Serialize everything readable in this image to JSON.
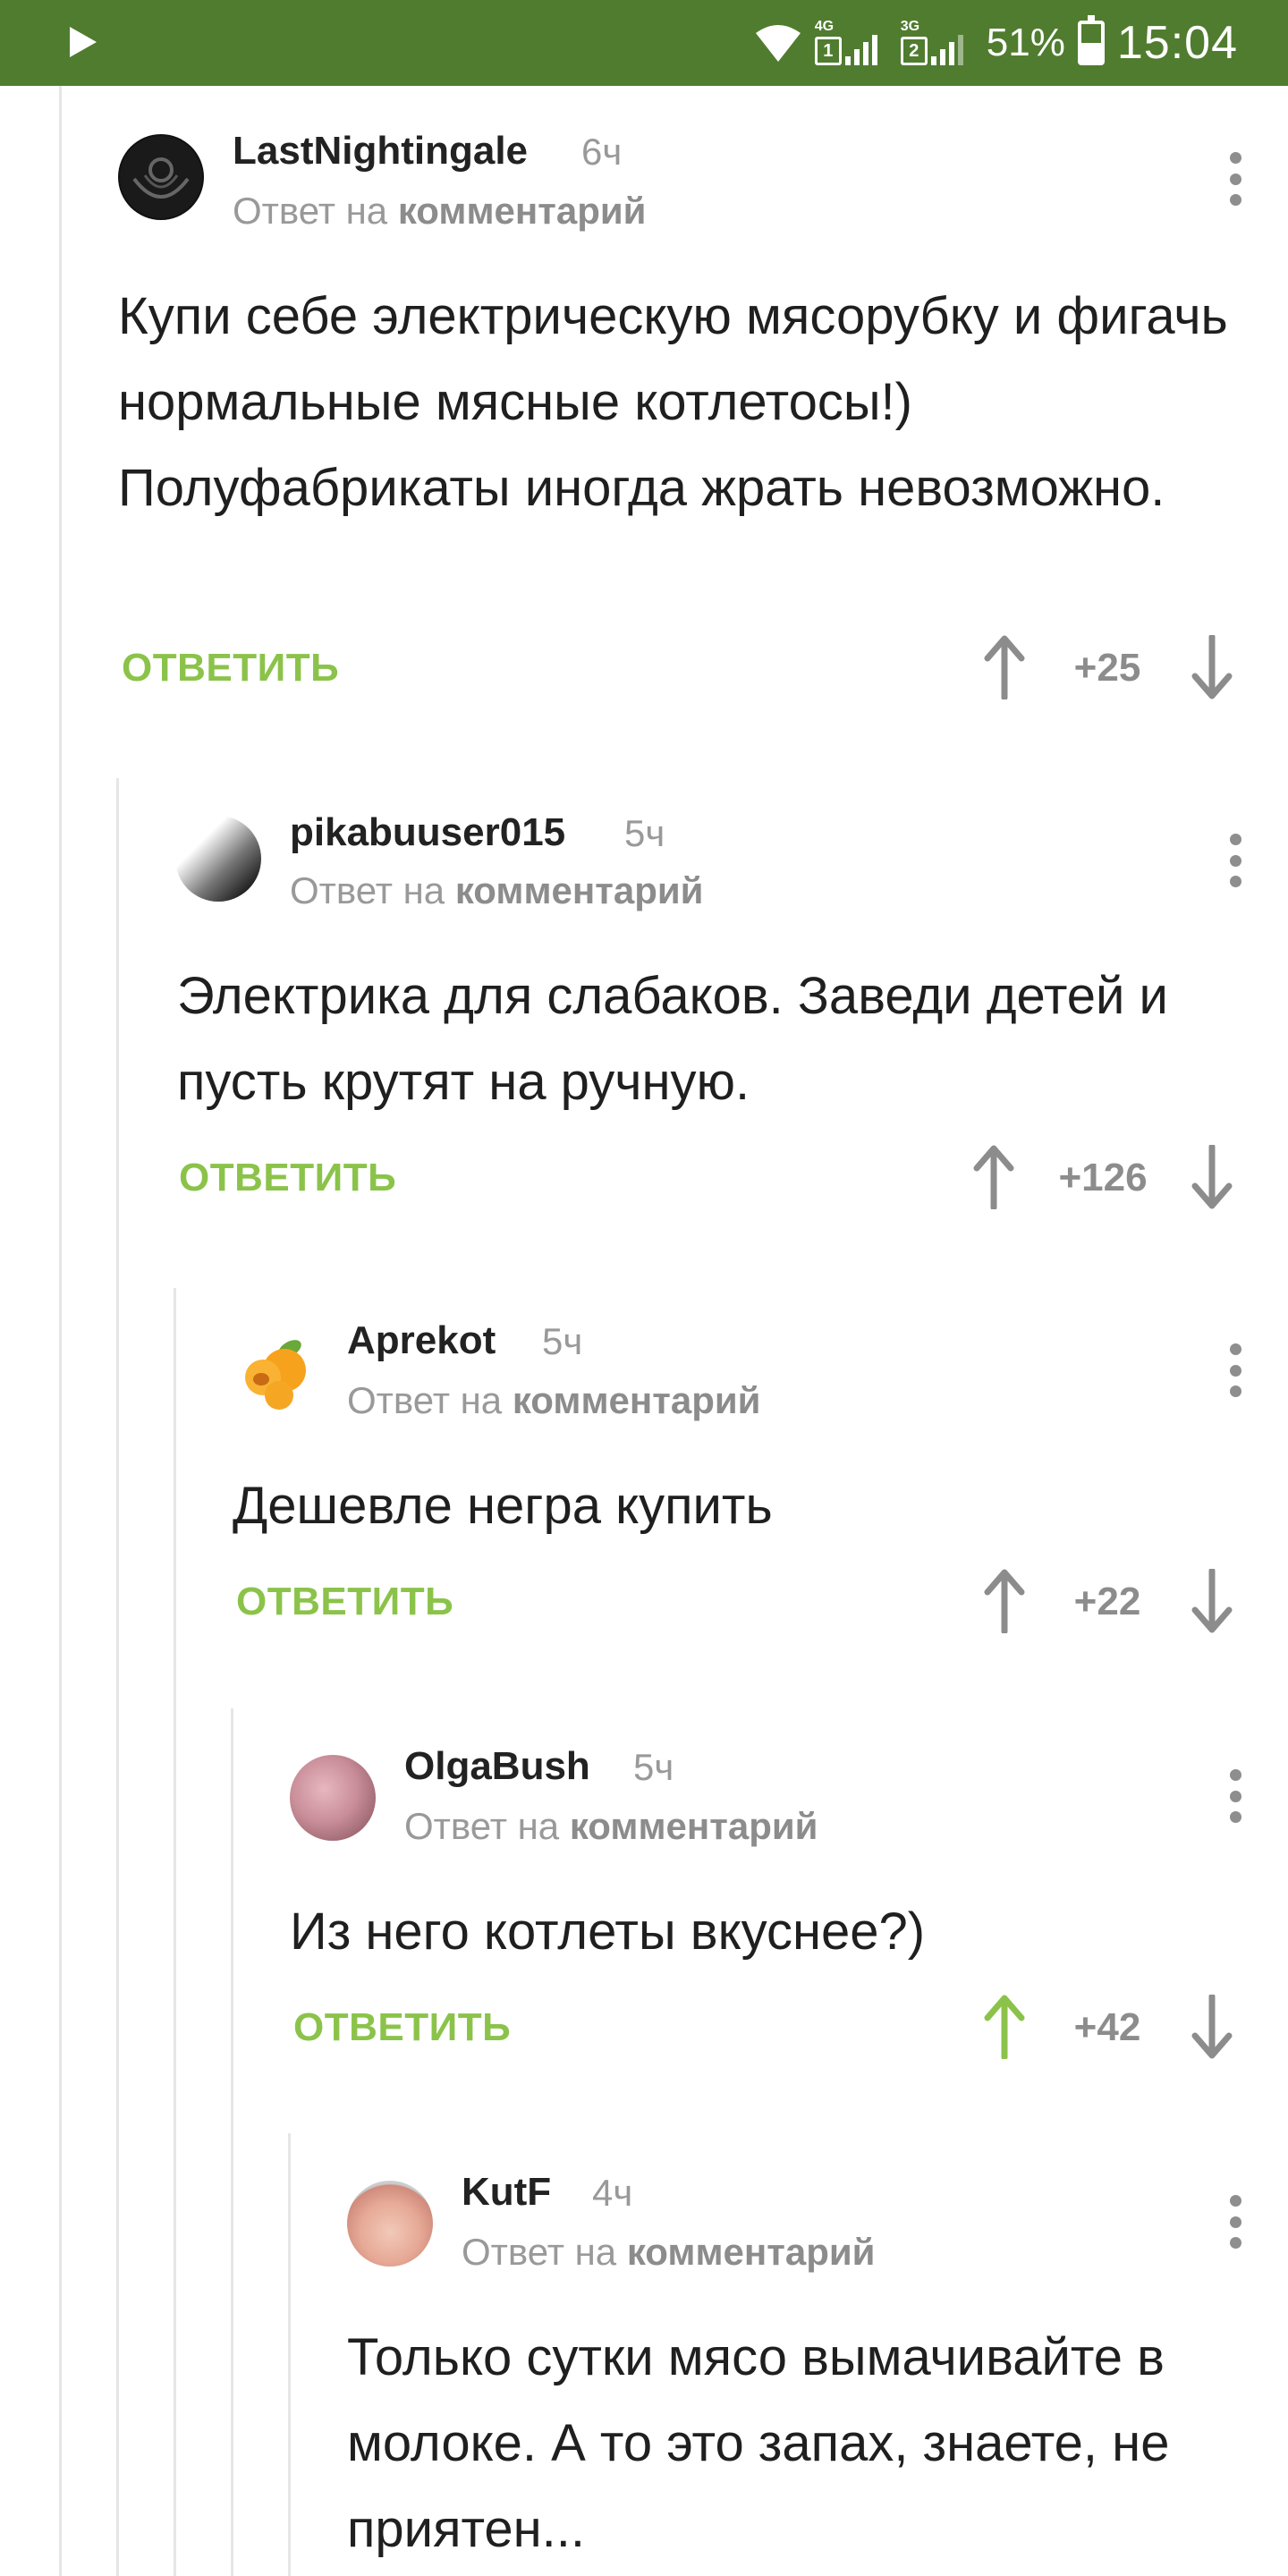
{
  "status_bar": {
    "network_1": "4G",
    "sim_1": "1",
    "network_2": "3G",
    "sim_2": "2",
    "battery": "51%",
    "time": "15:04",
    "bg_color": "#507c2f"
  },
  "labels": {
    "reply_to_prefix": "Ответ на",
    "reply_to_target": "комментарий",
    "reply_button": "ОТВЕТИТЬ"
  },
  "comments": [
    {
      "author": "LastNightingale",
      "time": "6ч",
      "text": "Купи себе электрическую мясорубку и фигачь нормальные мясные котлетосы!) Полуфабрикаты иногда жрать невозможно.",
      "rating": "+25",
      "upvoted": false,
      "avatar_icon": "dark-emblem-avatar"
    },
    {
      "author": "pikabuuser015",
      "time": "5ч",
      "text": "Электрика для слабаков. Заведи детей и пусть крутят на ручную.",
      "rating": "+126",
      "upvoted": false,
      "avatar_icon": "gradient-avatar"
    },
    {
      "author": "Aprekot",
      "time": "5ч",
      "text": "Дешевле негра купить",
      "rating": "+22",
      "upvoted": false,
      "avatar_icon": "apricot-avatar"
    },
    {
      "author": "OlgaBush",
      "time": "5ч",
      "text": "Из него котлеты вкуснее?)",
      "rating": "+42",
      "upvoted": true,
      "avatar_icon": "photo-avatar"
    },
    {
      "author": "KutF",
      "time": "4ч",
      "text": "Только сутки мясо вымачивайте в молоке. А то это запах, знаете, не приятен...",
      "rating": "",
      "upvoted": false,
      "avatar_icon": "baby-photo-avatar"
    }
  ],
  "colors": {
    "accent_green": "#8bc34a",
    "vote_gray": "#8c8c8c",
    "upvoted_green": "#8bc34a"
  }
}
